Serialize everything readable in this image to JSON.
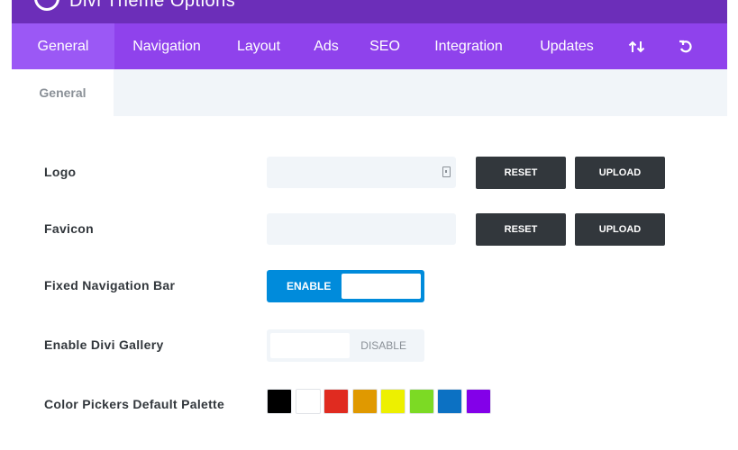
{
  "header": {
    "title": "Divi Theme Options"
  },
  "main_tabs": [
    {
      "label": "General"
    },
    {
      "label": "Navigation"
    },
    {
      "label": "Layout"
    },
    {
      "label": "Ads"
    },
    {
      "label": "SEO"
    },
    {
      "label": "Integration"
    },
    {
      "label": "Updates"
    }
  ],
  "main_tab_icons": [
    "import-export-icon",
    "reset-icon"
  ],
  "sub_tabs": [
    {
      "label": "General"
    }
  ],
  "settings": {
    "logo": {
      "label": "Logo",
      "value": "",
      "reset_label": "RESET",
      "upload_label": "UPLOAD"
    },
    "favicon": {
      "label": "Favicon",
      "value": "",
      "reset_label": "RESET",
      "upload_label": "UPLOAD"
    },
    "fixed_nav": {
      "label": "Fixed Navigation Bar",
      "state_label": "ENABLE",
      "enabled": true
    },
    "divi_gallery": {
      "label": "Enable Divi Gallery",
      "state_label": "DISABLE",
      "enabled": false
    },
    "palette": {
      "label": "Color Pickers Default Palette",
      "colors": [
        "#000000",
        "#ffffff",
        "#e02b20",
        "#e09900",
        "#edf000",
        "#7cda24",
        "#0c71c3",
        "#8300e9"
      ]
    }
  },
  "colors": {
    "accent": "#8f42ec",
    "toggle_on": "#008bdb",
    "button": "#32373c"
  }
}
